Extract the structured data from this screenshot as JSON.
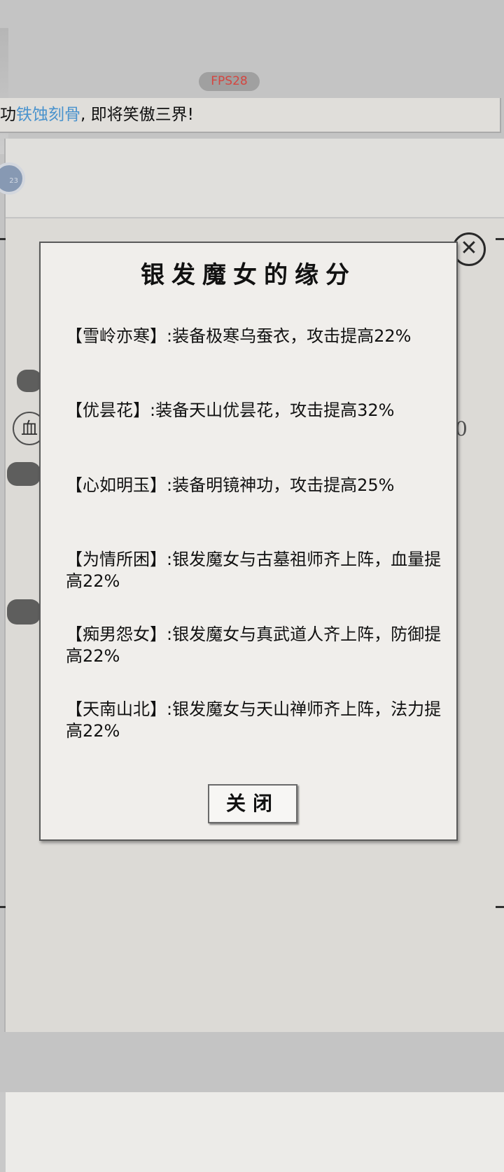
{
  "hud": {
    "fps": "FPS28"
  },
  "ticker": {
    "prefix": "功",
    "highlight": "铁蚀刻骨",
    "suffix": ", 即将笑傲三界!"
  },
  "avatar": {
    "badge": "23"
  },
  "background": {
    "seal_char": "血",
    "right_digit": "0"
  },
  "modal": {
    "title": "银发魔女的缘分",
    "bonds": [
      {
        "text": "【雪岭亦寒】:装备极寒乌蚕衣，攻击提高22%"
      },
      {
        "text": "【优昙花】:装备天山优昙花，攻击提高32%"
      },
      {
        "text": "【心如明玉】:装备明镜神功，攻击提高25%"
      },
      {
        "text": "【为情所困】:银发魔女与古墓祖师齐上阵，血量提高22%"
      },
      {
        "text": "【痴男怨女】:银发魔女与真武道人齐上阵，防御提高22%"
      },
      {
        "text": "【天南山北】:银发魔女与天山禅师齐上阵，法力提高22%"
      }
    ],
    "close_label": "关闭"
  }
}
